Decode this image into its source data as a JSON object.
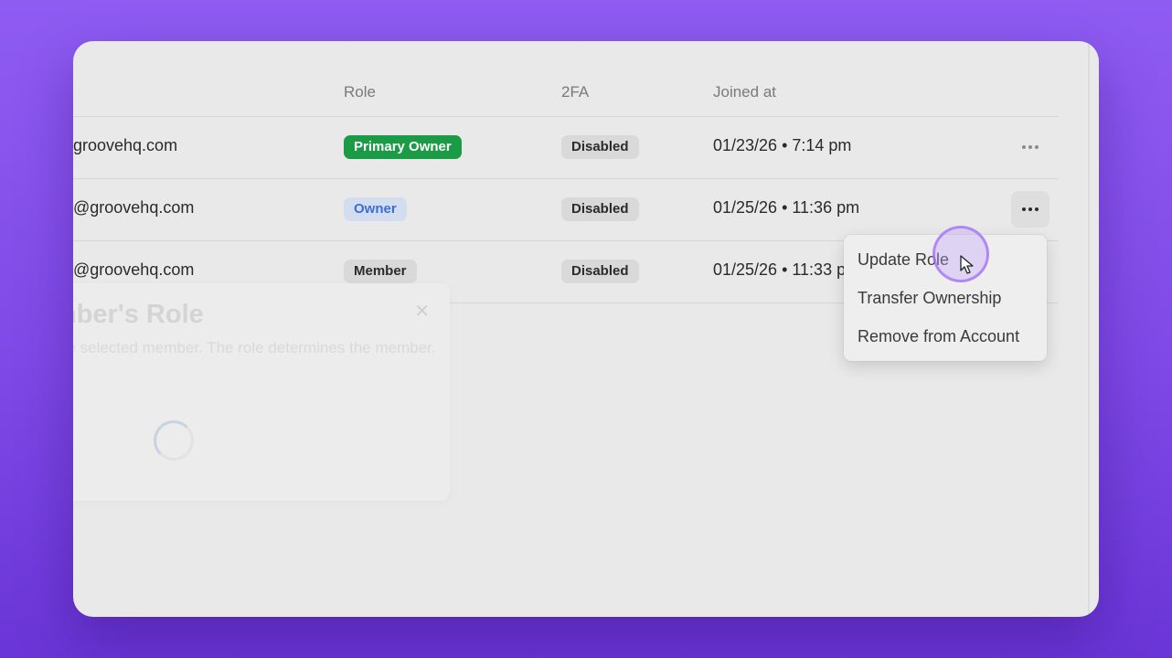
{
  "table": {
    "headers": {
      "role": "Role",
      "twofa": "2FA",
      "joined": "Joined at"
    },
    "rows": [
      {
        "email": "groovehq.com",
        "role": "Primary Owner",
        "role_color": "#1b9b46",
        "twofa": "Disabled",
        "joined": "01/23/26 • 7:14 pm"
      },
      {
        "email": "@groovehq.com",
        "role": "Owner",
        "role_color": "#3b6fd6",
        "twofa": "Disabled",
        "joined": "01/25/26 • 11:36 pm"
      },
      {
        "email": "@groovehq.com",
        "role": "Member",
        "role_color": "#2b2b2b",
        "twofa": "Disabled",
        "joined": "01/25/26 • 11:33 pm"
      }
    ],
    "more_icon": "ellipsis-icon"
  },
  "dropdown": {
    "items": [
      {
        "label": "Update Role"
      },
      {
        "label": "Transfer Ownership"
      },
      {
        "label": "Remove from Account"
      }
    ]
  },
  "modal": {
    "title": "nber's Role",
    "description": "he selected member. The role determines the member.",
    "close_icon": "close-icon",
    "state": "loading"
  },
  "colors": {
    "background": "#8f5cf2",
    "window": "#e9e9e9",
    "accent_ring": "#a06ef5"
  }
}
